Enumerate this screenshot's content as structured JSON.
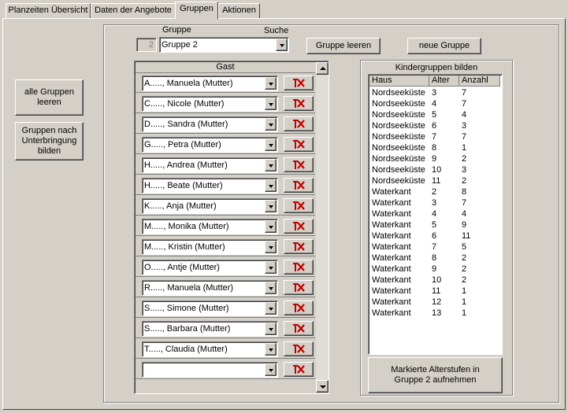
{
  "tabs": [
    {
      "label": "Planzeiten Übersicht",
      "active": false
    },
    {
      "label": "Daten der Angebote",
      "active": false
    },
    {
      "label": "Gruppen",
      "active": true
    },
    {
      "label": "Aktionen",
      "active": false
    }
  ],
  "left_buttons": {
    "clear_all": "alle Gruppen leeren",
    "by_accommodation": "Gruppen nach Unterbringung bilden"
  },
  "group_select": {
    "label": "Gruppe",
    "number": "2",
    "value": "Gruppe 2",
    "search_label": "Suche"
  },
  "top_buttons": {
    "clear_group": "Gruppe leeren",
    "new_group": "neue Gruppe"
  },
  "guests": {
    "header": "Gast",
    "rows": [
      "A....., Manuela (Mutter)",
      "C....., Nicole (Mutter)",
      "D....., Sandra (Mutter)",
      "G....., Petra (Mutter)",
      "H....., Andrea (Mutter)",
      "H....., Beate (Mutter)",
      "K....., Anja (Mutter)",
      "M....., Monika (Mutter)",
      "M....., Kristin (Mutter)",
      "O....., Antje (Mutter)",
      "R....., Manuela (Mutter)",
      "S....., Simone (Mutter)",
      "S....., Barbara (Mutter)",
      "T....., Claudia (Mutter)",
      ""
    ]
  },
  "kindergruppen": {
    "title": "Kindergruppen bilden",
    "columns": {
      "haus": "Haus",
      "alter": "Alter",
      "anzahl": "Anzahl"
    },
    "rows": [
      {
        "haus": "Nordseeküste",
        "alter": "3",
        "anzahl": "7"
      },
      {
        "haus": "Nordseeküste",
        "alter": "4",
        "anzahl": "7"
      },
      {
        "haus": "Nordseeküste",
        "alter": "5",
        "anzahl": "4"
      },
      {
        "haus": "Nordseeküste",
        "alter": "6",
        "anzahl": "3"
      },
      {
        "haus": "Nordseeküste",
        "alter": "7",
        "anzahl": "7"
      },
      {
        "haus": "Nordseeküste",
        "alter": "8",
        "anzahl": "1"
      },
      {
        "haus": "Nordseeküste",
        "alter": "9",
        "anzahl": "2"
      },
      {
        "haus": "Nordseeküste",
        "alter": "10",
        "anzahl": "3"
      },
      {
        "haus": "Nordseeküste",
        "alter": "11",
        "anzahl": "2"
      },
      {
        "haus": "Waterkant",
        "alter": "2",
        "anzahl": "8"
      },
      {
        "haus": "Waterkant",
        "alter": "3",
        "anzahl": "7"
      },
      {
        "haus": "Waterkant",
        "alter": "4",
        "anzahl": "4"
      },
      {
        "haus": "Waterkant",
        "alter": "5",
        "anzahl": "9"
      },
      {
        "haus": "Waterkant",
        "alter": "6",
        "anzahl": "11"
      },
      {
        "haus": "Waterkant",
        "alter": "7",
        "anzahl": "5"
      },
      {
        "haus": "Waterkant",
        "alter": "8",
        "anzahl": "2"
      },
      {
        "haus": "Waterkant",
        "alter": "9",
        "anzahl": "2"
      },
      {
        "haus": "Waterkant",
        "alter": "10",
        "anzahl": "2"
      },
      {
        "haus": "Waterkant",
        "alter": "11",
        "anzahl": "1"
      },
      {
        "haus": "Waterkant",
        "alter": "12",
        "anzahl": "1"
      },
      {
        "haus": "Waterkant",
        "alter": "13",
        "anzahl": "1"
      }
    ],
    "add_button": "Markierte Alterstufen in Gruppe 2 aufnehmen"
  },
  "icons": {
    "dropdown": "chevron-down-icon",
    "remove": "remove-guest-icon",
    "scroll_up": "scroll-up-icon",
    "scroll_down": "scroll-down-icon"
  },
  "colors": {
    "face": "#d4d0c8",
    "remove_icon": "#c00000"
  }
}
